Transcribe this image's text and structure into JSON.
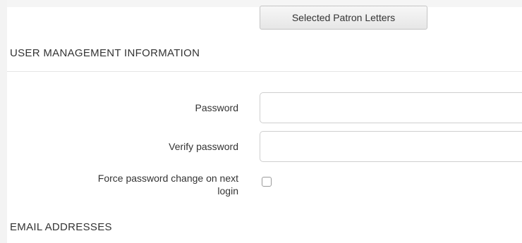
{
  "toolbar": {
    "letters_button_label": "Selected Patron Letters"
  },
  "user_management": {
    "section_title": "USER MANAGEMENT INFORMATION",
    "password_label": "Password",
    "password_value": "",
    "verify_password_label": "Verify password",
    "verify_password_value": "",
    "force_change_label_line1": "Force password change on next",
    "force_change_label_line2": "login",
    "force_change_checked": false
  },
  "email": {
    "section_title": "EMAIL ADDRESSES"
  }
}
